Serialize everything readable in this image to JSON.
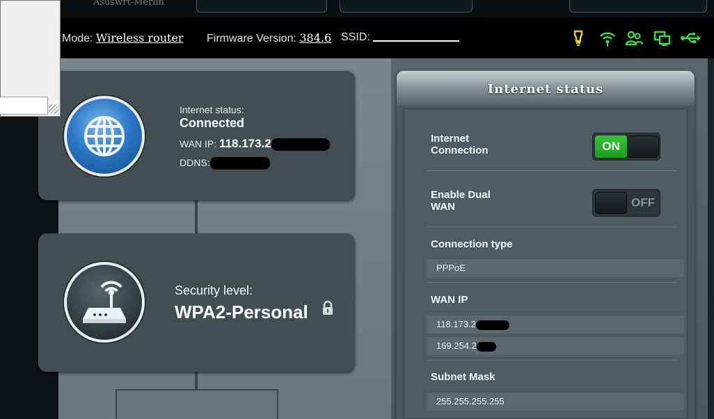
{
  "header": {
    "brand_text": "Asuswrt-Merlin",
    "mode_label": "Mode:",
    "mode_value": "Wireless router",
    "firmware_label": "Firmware Version:",
    "firmware_value": "384.6",
    "ssid_label": "SSID:",
    "ssid_value": "",
    "status_icons": [
      "lightbulb-icon",
      "wifi-icon",
      "users-icon",
      "screens-icon",
      "usb-icon"
    ],
    "status_icon_color": "#3ddc3d",
    "bulb_color": "#f0d000"
  },
  "internet_card": {
    "status_label": "Internet status:",
    "status_value": "Connected",
    "wan_ip_label": "WAN IP:",
    "wan_ip_value": "118.173.2",
    "ddns_label": "DDNS:"
  },
  "security_card": {
    "label": "Security level:",
    "value": "WPA2-Personal"
  },
  "panel": {
    "title": "Internet status",
    "internet_connection_label": "Internet Connection",
    "internet_connection_toggle": "ON",
    "dual_wan_label": "Enable Dual WAN",
    "dual_wan_toggle": "OFF",
    "connection_type_label": "Connection type",
    "connection_type_value": "PPPoE",
    "wan_ip_label": "WAN IP",
    "wan_ip_values": [
      "118.173.2",
      "169.254.2"
    ],
    "subnet_mask_label": "Subnet Mask",
    "subnet_mask_value": "255.255.255.255"
  },
  "colors": {
    "accent_green": "#2fbf33",
    "globe_blue": "#2d79c6"
  }
}
